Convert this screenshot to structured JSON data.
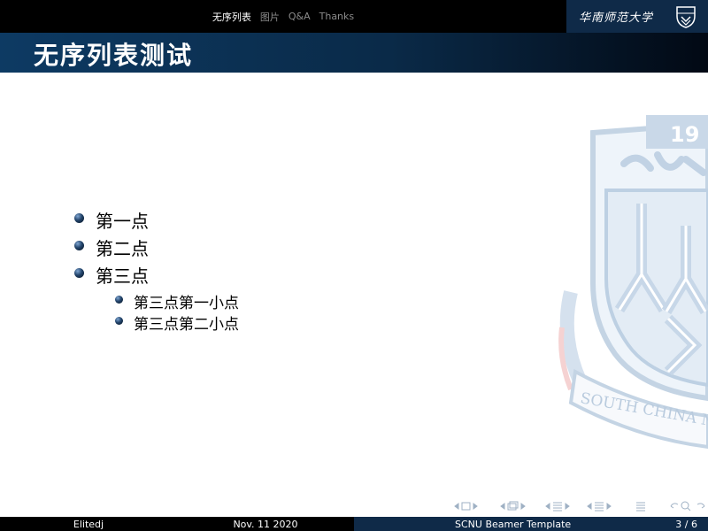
{
  "nav": {
    "sections": [
      "无序列表",
      "图片",
      "Q&A",
      "Thanks"
    ],
    "active_index": 0
  },
  "logo": {
    "text": "华南师范大学",
    "seal_top_text": "19",
    "seal_band_text": "SOUTH CHINA NOR"
  },
  "frame": {
    "title": "无序列表测试"
  },
  "list": {
    "items": [
      "第一点",
      "第二点",
      "第三点"
    ],
    "sub_items": [
      "第三点第一小点",
      "第三点第二小点"
    ]
  },
  "footer": {
    "author": "Elitedj",
    "date": "Nov. 11 2020",
    "title": "SCNU Beamer Template",
    "page": "3 / 6"
  },
  "colors": {
    "nav_background": "#000000",
    "title_bar_start": "#0d3a63",
    "title_bar_end": "#020914",
    "logo_background": "#0f2a48",
    "footer_title_background": "#0f2a48",
    "bullet": "#22436a",
    "watermark_blue": "#c9d8e8",
    "watermark_red": "#f3c9c9"
  }
}
